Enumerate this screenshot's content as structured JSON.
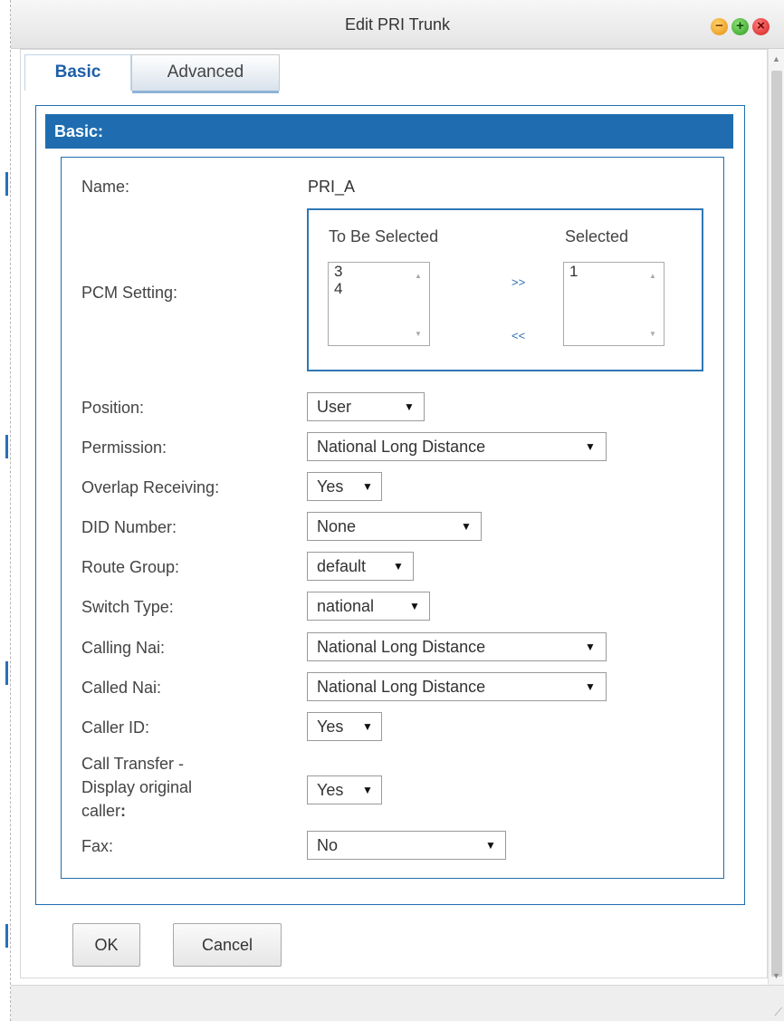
{
  "window": {
    "title": "Edit PRI Trunk"
  },
  "tabs": {
    "basic": "Basic",
    "advanced": "Advanced"
  },
  "section": {
    "title": "Basic:"
  },
  "form": {
    "name": {
      "label": "Name:",
      "value": "PRI_A"
    },
    "pcm": {
      "label": "PCM Setting:",
      "to_be_selected_title": "To Be Selected",
      "selected_title": "Selected",
      "to_be_selected": [
        "3",
        "4"
      ],
      "selected": [
        "1"
      ],
      "add_label": ">>",
      "remove_label": "<<"
    },
    "position": {
      "label": "Position:",
      "value": "User"
    },
    "permission": {
      "label": "Permission:",
      "value": "National Long Distance"
    },
    "overlap_receiving": {
      "label": "Overlap Receiving:",
      "value": "Yes"
    },
    "did_number": {
      "label": "DID Number:",
      "value": "None"
    },
    "route_group": {
      "label": "Route Group:",
      "value": "default"
    },
    "switch_type": {
      "label": "Switch Type:",
      "value": "national"
    },
    "calling_nai": {
      "label": "Calling Nai:",
      "value": "National Long Distance"
    },
    "called_nai": {
      "label": "Called Nai:",
      "value": "National Long Distance"
    },
    "caller_id": {
      "label": "Caller ID:",
      "value": "Yes"
    },
    "call_transfer": {
      "label_line1": "Call Transfer -",
      "label_line2": "Display original",
      "label_line3": "caller",
      "label_colon": ":",
      "value": "Yes"
    },
    "fax": {
      "label": "Fax:",
      "value": "No"
    }
  },
  "buttons": {
    "ok": "OK",
    "cancel": "Cancel"
  },
  "icons": {
    "dropdown": "▼",
    "minimize": "minimize-icon",
    "maximize": "maximize-icon",
    "close": "close-icon"
  },
  "colors": {
    "accent": "#1f6db0"
  }
}
